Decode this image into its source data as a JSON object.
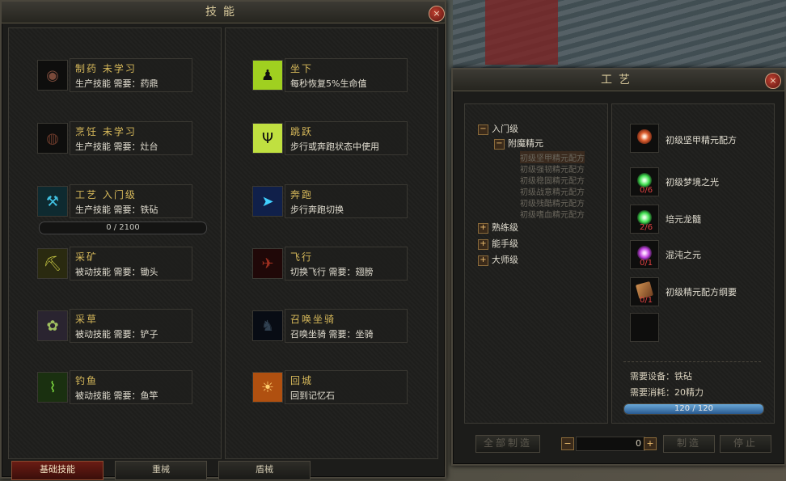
{
  "skills_window": {
    "title": "技能",
    "close": "×",
    "left_skills": [
      {
        "name": "制药 未学习",
        "desc": "生产技能 需要：药鼎",
        "icon": "pill-icon"
      },
      {
        "name": "烹饪 未学习",
        "desc": "生产技能 需要：灶台",
        "icon": "cooking-pot-icon"
      },
      {
        "name": "工艺 入门级",
        "desc": "生产技能 需要：铁砧",
        "icon": "craft-hammer-icon"
      },
      {
        "name": "采矿",
        "desc": "被动技能 需要：锄头",
        "icon": "mining-icon"
      },
      {
        "name": "采草",
        "desc": "被动技能 需要：铲子",
        "icon": "herb-icon"
      },
      {
        "name": "钓鱼",
        "desc": "被动技能 需要：鱼竿",
        "icon": "fishing-icon"
      }
    ],
    "right_skills": [
      {
        "name": "坐下",
        "desc": "每秒恢复5%生命值",
        "icon": "sit-icon"
      },
      {
        "name": "跳跃",
        "desc": "步行或奔跑状态中使用",
        "icon": "jump-icon"
      },
      {
        "name": "奔跑",
        "desc": "步行奔跑切换",
        "icon": "run-icon"
      },
      {
        "name": "飞行",
        "desc": "切换飞行 需要：翅膀",
        "icon": "fly-icon"
      },
      {
        "name": "召唤坐骑",
        "desc": "召唤坐骑 需要：坐骑",
        "icon": "horse-icon"
      },
      {
        "name": "回城",
        "desc": "回到记忆石",
        "icon": "scroll-icon"
      }
    ],
    "craft_progress": {
      "text": "0 / 2100",
      "current": 0,
      "max": 2100
    },
    "tabs": [
      "基础技能",
      "重械",
      "盾械"
    ],
    "active_tab": 0
  },
  "craft_window": {
    "title": "工艺",
    "close": "×",
    "tree": {
      "level1": {
        "label": "入门级",
        "toggle": "−"
      },
      "group": {
        "label": "附魔精元",
        "toggle": "−"
      },
      "recipes": [
        "初级坚甲精元配方",
        "初级强韧精元配方",
        "初级稳固精元配方",
        "初级战意精元配方",
        "初级残酷精元配方",
        "初级嗜血精元配方"
      ],
      "others": [
        {
          "label": "熟练级",
          "toggle": "+"
        },
        {
          "label": "能手级",
          "toggle": "+"
        },
        {
          "label": "大师级",
          "toggle": "+"
        }
      ]
    },
    "product": {
      "name": "初级坚甲精元配方",
      "icon": "recipe-orb-icon"
    },
    "materials": [
      {
        "name": "初级梦境之光",
        "count": "0/6",
        "color": "#40e050"
      },
      {
        "name": "培元龙髓",
        "count": "2/6",
        "color": "#40e050"
      },
      {
        "name": "混沌之元",
        "count": "0/1",
        "color": "#c040e0"
      },
      {
        "name": "初级精元配方纲要",
        "count": "0/1",
        "color": "#b07a40"
      }
    ],
    "req_device": "需要设备：铁砧",
    "req_cost": "需要消耗：20精力",
    "energy": {
      "text": "120 / 120",
      "current": 120,
      "max": 120
    },
    "buttons": {
      "craft_all": "全部制造",
      "craft": "制造",
      "stop": "停止"
    },
    "quantity": "0",
    "minus": "−",
    "plus": "+"
  }
}
